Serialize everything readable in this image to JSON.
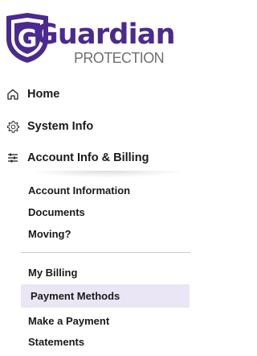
{
  "brand": {
    "name": "Guardian",
    "tagline": "PROTECTION",
    "color": "#4b2a8f",
    "shield_letter": "G"
  },
  "nav": {
    "home": {
      "label": "Home",
      "icon": "home-icon"
    },
    "system_info": {
      "label": "System Info",
      "icon": "gear-icon"
    },
    "account_billing": {
      "label": "Account Info & Billing",
      "icon": "sliders-icon"
    }
  },
  "account_submenu": [
    {
      "label": "Account Information"
    },
    {
      "label": "Documents"
    },
    {
      "label": "Moving?"
    }
  ],
  "billing_submenu": [
    {
      "label": "My Billing"
    },
    {
      "label": "Payment Methods",
      "active": true
    },
    {
      "label": "Make a Payment"
    },
    {
      "label": "Statements"
    }
  ],
  "colors": {
    "active_bg": "#ebe6f6",
    "text": "#1a1a1a",
    "subtle": "#707070"
  }
}
